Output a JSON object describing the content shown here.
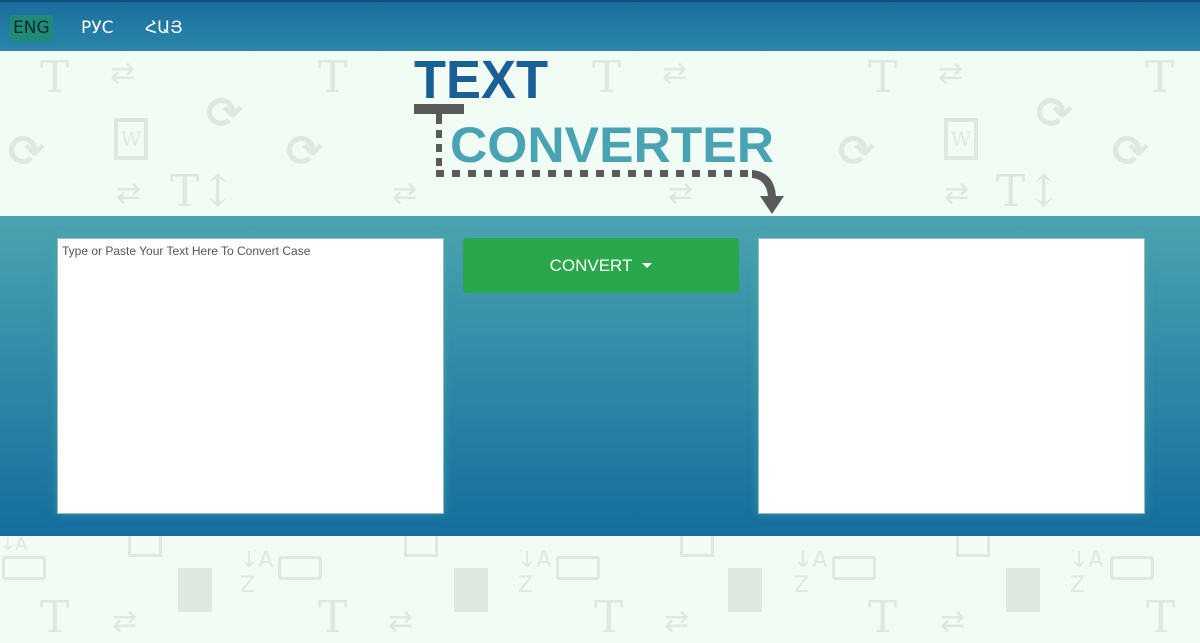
{
  "nav": {
    "languages": [
      "ENG",
      "РУС",
      "ՀԱՅ"
    ],
    "active_language": "ENG"
  },
  "logo": {
    "line1": "TEXT",
    "line2": "CONVERTER"
  },
  "input": {
    "placeholder": "Type or Paste Your Text Here To Convert Case",
    "value": ""
  },
  "output": {
    "value": ""
  },
  "convert_button": {
    "label": "CONVERT"
  },
  "colors": {
    "nav_bg": "#1a6e9f",
    "active_lang_bg": "#1f8a77",
    "panel_top": "#4ba3b0",
    "panel_bottom": "#156d9e",
    "button_green": "#28a84a",
    "logo_blue": "#1a5f96",
    "logo_teal": "#4aa3b2",
    "logo_gray": "#5a5a5a",
    "page_bg": "#f1fdf4"
  },
  "icons": {
    "background_pattern": [
      "text-T-icon",
      "swap-arrows-icon",
      "refresh-icon",
      "word-doc-icon",
      "keyboard-icon",
      "document-icon",
      "sort-az-icon",
      "tablet-icon"
    ],
    "dropdown": "caret-down-icon"
  }
}
